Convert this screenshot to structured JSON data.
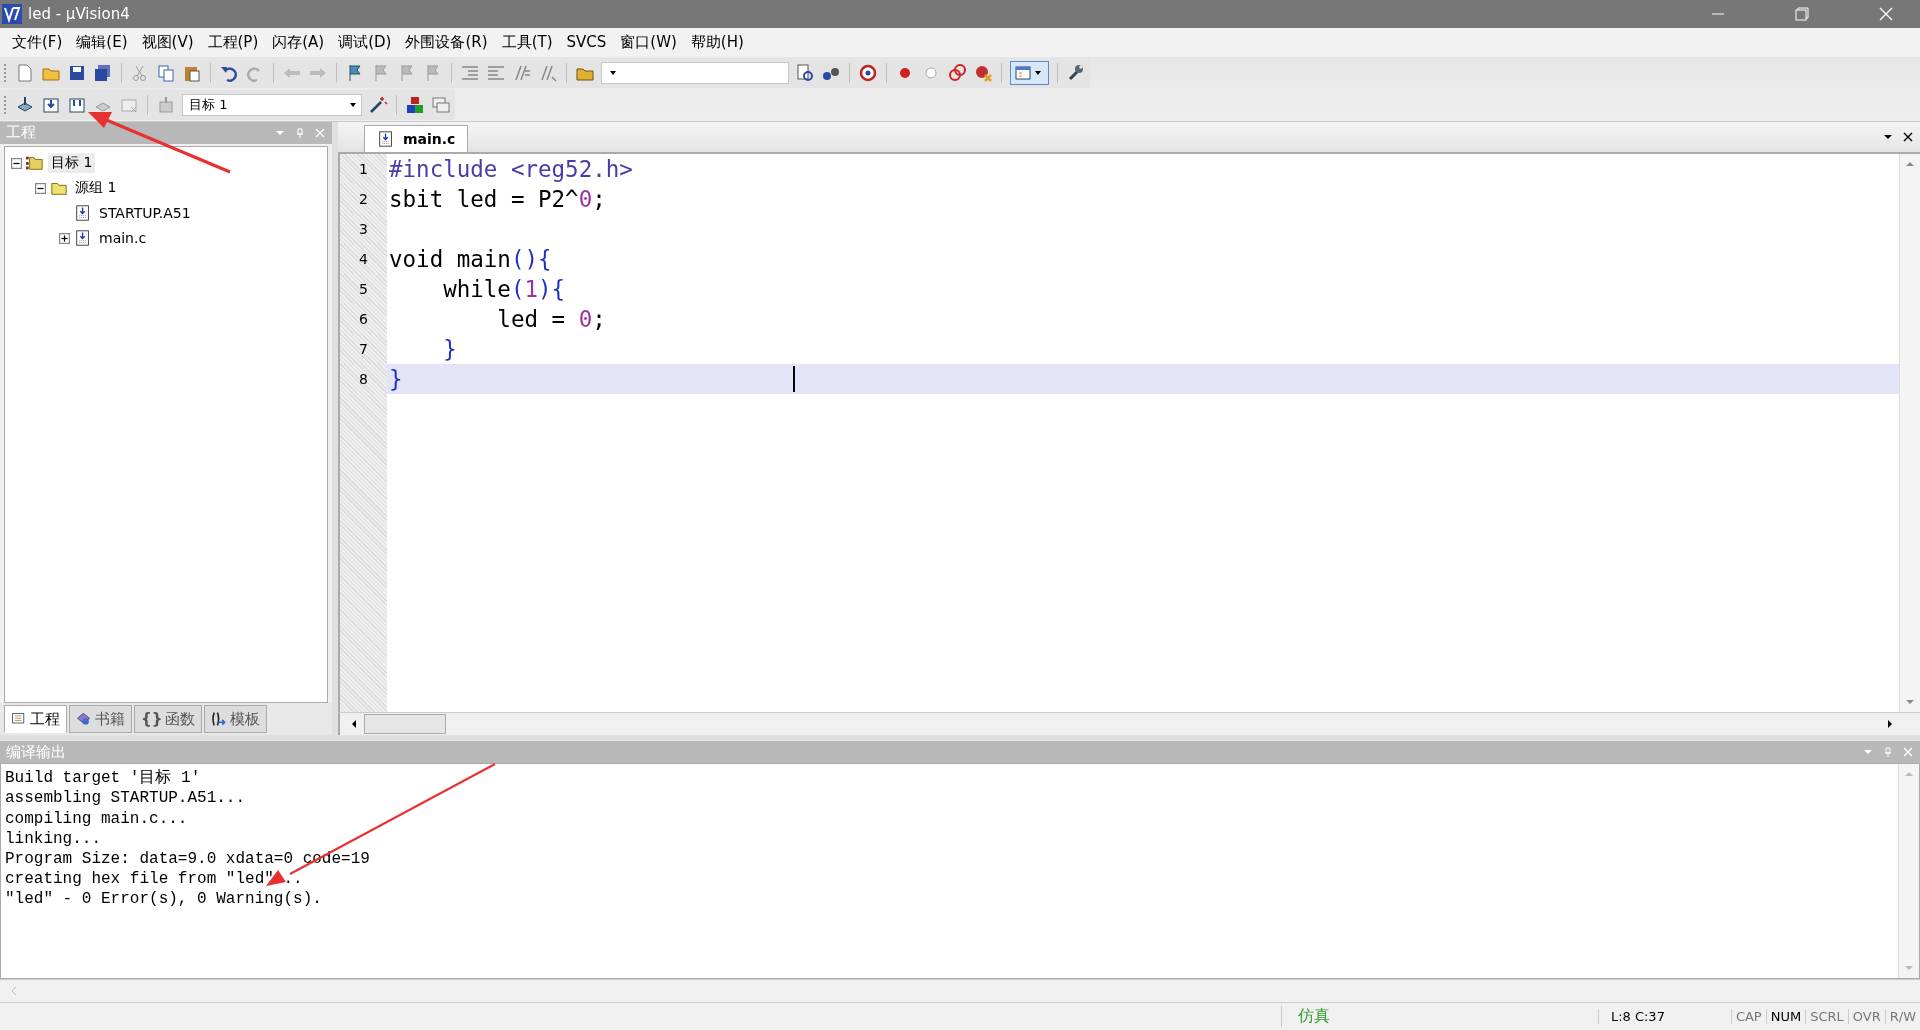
{
  "window": {
    "title": "led  - µVision4"
  },
  "menu": [
    {
      "label": "文件(F)"
    },
    {
      "label": "编辑(E)"
    },
    {
      "label": "视图(V)"
    },
    {
      "label": "工程(P)"
    },
    {
      "label": "闪存(A)"
    },
    {
      "label": "调试(D)"
    },
    {
      "label": "外围设备(R)"
    },
    {
      "label": "工具(T)"
    },
    {
      "label": "SVCS"
    },
    {
      "label": "窗口(W)"
    },
    {
      "label": "帮助(H)"
    }
  ],
  "toolbar": {
    "target_select": {
      "value": "目标 1"
    }
  },
  "project_panel": {
    "title": "工程",
    "tree": [
      {
        "label": "目标 1",
        "kind": "target",
        "expanded": true,
        "selected": true,
        "children": [
          {
            "label": "源组 1",
            "kind": "group",
            "expanded": true,
            "selected": false,
            "children": [
              {
                "label": "STARTUP.A51",
                "kind": "file",
                "selected": false
              },
              {
                "label": "main.c",
                "kind": "file",
                "expanded": false,
                "selected": false
              }
            ]
          }
        ]
      }
    ],
    "tabs": [
      {
        "label": "工程",
        "kind": "project",
        "selected": true
      },
      {
        "label": "书籍",
        "kind": "books",
        "selected": false
      },
      {
        "label": "函数",
        "kind": "functions",
        "glyph": "{}",
        "selected": false
      },
      {
        "label": "模板",
        "kind": "templates",
        "selected": false
      }
    ]
  },
  "editor": {
    "tabs": [
      {
        "label": "main.c",
        "selected": true
      }
    ],
    "lines": [
      {
        "number": "1",
        "current": false,
        "tokens": [
          {
            "kind": "directive",
            "text": "#include <reg52.h>"
          }
        ]
      },
      {
        "number": "2",
        "current": false,
        "tokens": [
          {
            "kind": "plain",
            "text": "sbit led = P2^"
          },
          {
            "kind": "number",
            "text": "0"
          },
          {
            "kind": "plain",
            "text": ";"
          }
        ]
      },
      {
        "number": "3",
        "current": false
      },
      {
        "number": "4",
        "current": false,
        "tokens": [
          {
            "kind": "plain",
            "text": "void main"
          },
          {
            "kind": "brace",
            "text": "(){"
          }
        ]
      },
      {
        "number": "5",
        "current": false,
        "tokens": [
          {
            "kind": "plain",
            "text": "    while"
          },
          {
            "kind": "brace",
            "text": "("
          },
          {
            "kind": "number",
            "text": "1"
          },
          {
            "kind": "brace",
            "text": "){"
          }
        ]
      },
      {
        "number": "6",
        "current": false,
        "tokens": [
          {
            "kind": "plain",
            "text": "        led = "
          },
          {
            "kind": "number",
            "text": "0"
          },
          {
            "kind": "plain",
            "text": ";"
          }
        ]
      },
      {
        "number": "7",
        "current": false,
        "tokens": [
          {
            "kind": "brace",
            "text": "    }"
          }
        ]
      },
      {
        "number": "8",
        "current": true,
        "tokens": [
          {
            "kind": "brace",
            "text": "}"
          }
        ]
      }
    ]
  },
  "output_panel": {
    "title": "编译输出",
    "lines": [
      "Build target '目标 1'",
      "assembling STARTUP.A51...",
      "compiling main.c...",
      "linking...",
      "Program Size: data=9.0 xdata=0 code=19",
      "creating hex file from \"led\"...",
      "\"led\" - 0 Error(s), 0 Warning(s)."
    ]
  },
  "status_bar": {
    "mode": "仿真",
    "position": "L:8 C:37",
    "indicators": [
      {
        "label": "CAP",
        "on": false
      },
      {
        "label": "NUM",
        "on": true
      },
      {
        "label": "SCRL",
        "on": false
      },
      {
        "label": "OVR",
        "on": false
      },
      {
        "label": "R/W",
        "on": false
      }
    ]
  }
}
